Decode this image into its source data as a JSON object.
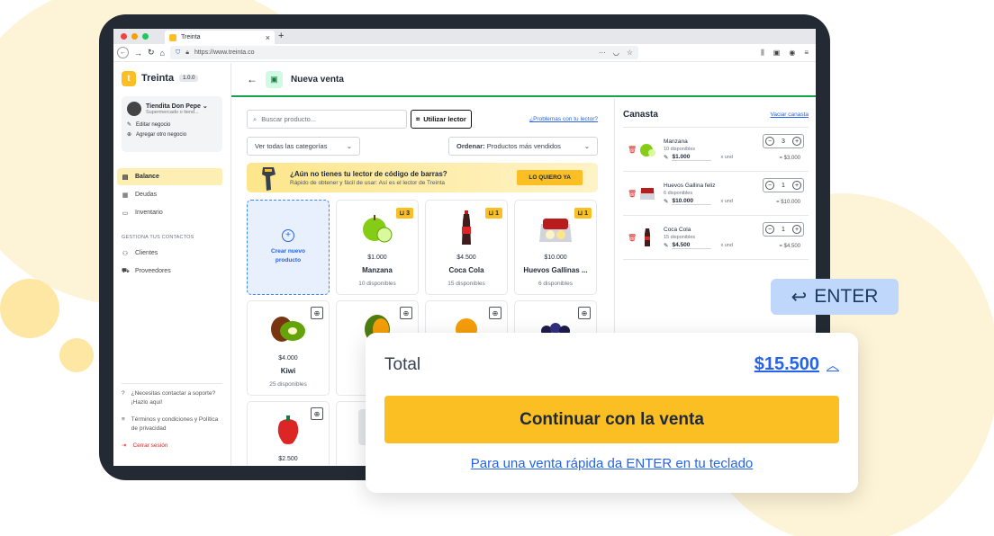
{
  "browser": {
    "tab_title": "Treinta",
    "url": "https://www.treinta.co"
  },
  "sidebar": {
    "brand": "Treinta",
    "version": "1.0.0",
    "business_name": "Tiendita Don Pepe",
    "business_sub": "Supermercado o tiend...",
    "edit_business": "Editar negocio",
    "add_business": "Agregar otro negocio",
    "items": [
      {
        "label": "Balance",
        "icon": "balance-icon"
      },
      {
        "label": "Deudas",
        "icon": "deudas-icon"
      },
      {
        "label": "Inventario",
        "icon": "inventario-icon"
      }
    ],
    "contacts_header": "GESTIONA TUS CONTACTOS",
    "contacts": [
      {
        "label": "Clientes",
        "icon": "clientes-icon"
      },
      {
        "label": "Proveedores",
        "icon": "proveedores-icon"
      }
    ],
    "support": "¿Necesitas contactar a soporte? ¡Hazlo aquí!",
    "terms": "Términos y condiciones y Política de privacidad",
    "logout": "Cerrar sesión"
  },
  "header": {
    "title": "Nueva venta"
  },
  "toolbar": {
    "search_placeholder": "Buscar producto...",
    "lector_label": "Utilizar lector",
    "problems_link": "¿Problemas con tu lector?",
    "category_select": "Ver todas las categorías",
    "order_label": "Ordenar:",
    "order_value": "Productos más vendidos"
  },
  "banner": {
    "title": "¿Aún no tienes tu lector de código de barras?",
    "subtitle": "Rápido de obtener y fácil de usar: Así es el lector de Treinta",
    "button": "LO QUIERO YA"
  },
  "create_card": {
    "line1": "Crear nuevo",
    "line2": "producto"
  },
  "products": [
    {
      "name": "Manzana",
      "price": "$1.000",
      "stock": "10 disponibles",
      "qty": "3"
    },
    {
      "name": "Coca Cola",
      "price": "$4.500",
      "stock": "15 disponibles",
      "qty": "1"
    },
    {
      "name": "Huevos Gallinas ...",
      "price": "$10.000",
      "stock": "6 disponibles",
      "qty": "1"
    },
    {
      "name": "Kiwi",
      "price": "$4.000",
      "stock": "25 disponibles"
    },
    {
      "price": "$2.500"
    }
  ],
  "cart": {
    "title": "Canasta",
    "clear": "Vaciar canasta",
    "unit_label": "x und",
    "items": [
      {
        "name": "Manzana",
        "stock": "10 disponibles",
        "price": "$1.000",
        "qty": "3",
        "subtotal": "= $3.000"
      },
      {
        "name": "Huevos Gallina feliz",
        "stock": "6 disponibles",
        "price": "$10.000",
        "qty": "1",
        "subtotal": "= $10.000"
      },
      {
        "name": "Coca Cola",
        "stock": "15 disponibles",
        "price": "$4.500",
        "qty": "1",
        "subtotal": "= $4.500"
      }
    ]
  },
  "enter_badge": "ENTER",
  "total": {
    "label": "Total",
    "value": "$15.500",
    "button": "Continuar con la venta",
    "hint": "Para una venta rápida da ENTER en tu teclado"
  },
  "colors": {
    "accent": "#fbbf24",
    "link": "#2563eb",
    "header_line": "#16a34a",
    "danger": "#dc2626"
  }
}
